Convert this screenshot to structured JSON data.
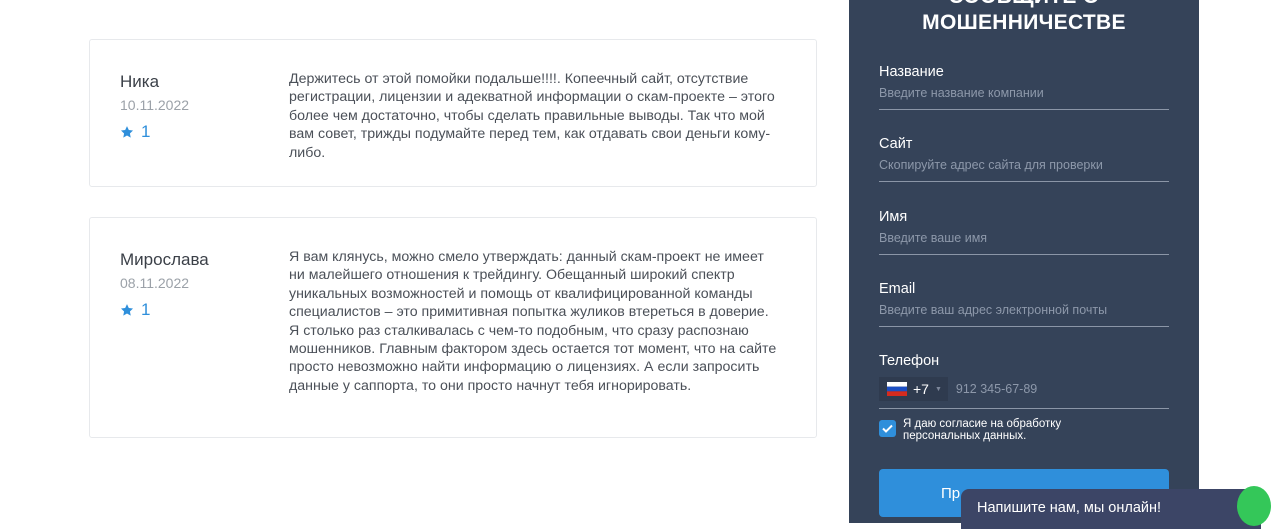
{
  "reviews": [
    {
      "author": "Ника",
      "date": "10.11.2022",
      "rating": "1",
      "text": "Держитесь от этой помойки подальше!!!!. Копеечный сайт, отсутствие регистрации, лицензии и адекватной информации о скам-проекте – этого более чем достаточно, чтобы сделать правильные выводы. Так что мой вам совет, трижды подумайте перед тем, как отдавать свои деньги кому-либо."
    },
    {
      "author": "Мирослава",
      "date": "08.11.2022",
      "rating": "1",
      "text": "Я вам клянусь, можно смело утверждать: данный скам-проект не имеет ни малейшего отношения к трейдингу. Обещанный широкий спектр уникальных возможностей и помощь от квалифицированной команды специалистов – это примитивная попытка жуликов втереться в доверие. Я столько раз сталкивалась с чем-то подобным, что сразу распознаю мошенников. Главным фактором здесь остается тот момент, что на сайте просто невозможно найти информацию о лицензиях. А если запросить данные у саппорта, то они просто начнут тебя игнорировать."
    }
  ],
  "form": {
    "title_line1": "Сообщите о",
    "title_line2": "мошенничестве",
    "fields": [
      {
        "label": "Название",
        "placeholder": "Введите название компании",
        "value": ""
      },
      {
        "label": "Сайт",
        "placeholder": "Скопируйте адрес сайта для проверки",
        "value": ""
      },
      {
        "label": "Имя",
        "placeholder": "Введите ваше имя",
        "value": ""
      },
      {
        "label": "Email",
        "placeholder": "Введите ваш адрес электронной почты",
        "value": ""
      }
    ],
    "phone": {
      "label": "Телефон",
      "dial_code": "+7",
      "placeholder": "912 345-67-89",
      "flag": "russia-flag-icon"
    },
    "consent": {
      "checked": true,
      "text": "Я даю согласие на обработку персональных данных."
    },
    "submit_label_visible": "Пр"
  },
  "chat": {
    "label": "Напишите нам, мы онлайн!"
  },
  "colors": {
    "panel_bg": "#354359",
    "accent": "#2f8fdb",
    "chat_bg": "#3c4566",
    "online_dot": "#34c759"
  },
  "icons": {
    "rating": "star-icon",
    "checkbox": "check-icon"
  }
}
